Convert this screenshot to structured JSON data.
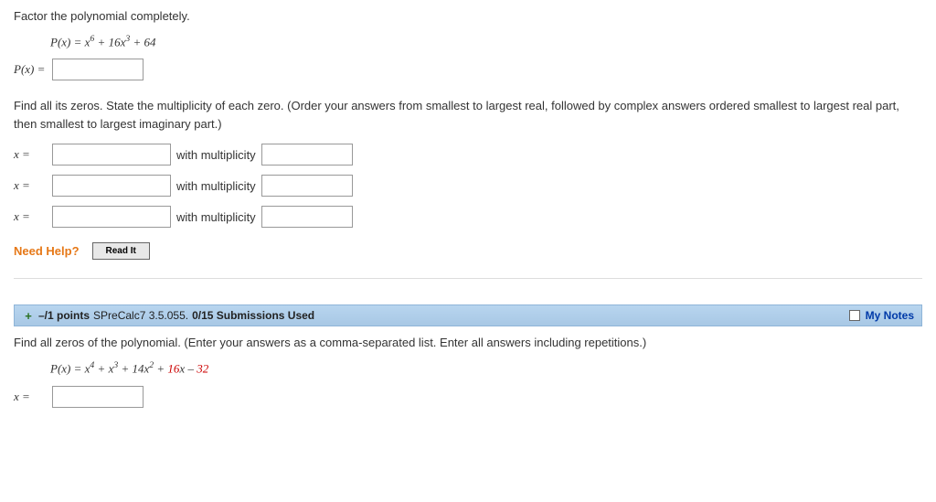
{
  "q1": {
    "prompt": "Factor the polynomial completely.",
    "formula_html": "P(x) = x<sup>6</sup> + 16x<sup>3</sup> + 64",
    "px_label": "P(x) =",
    "zeros_instruction": "Find all its zeros. State the multiplicity of each zero. (Order your answers from smallest to largest real, followed by complex answers ordered smallest to largest real part, then smallest to largest imaginary part.)",
    "x_label": "x =",
    "mult_label": "with multiplicity",
    "need_help": "Need Help?",
    "read_it": "Read It"
  },
  "q2header": {
    "points_prefix": "–/1 points",
    "source": "SPreCalc7 3.5.055.",
    "submissions": "0/15 Submissions Used",
    "my_notes": "My Notes"
  },
  "q2": {
    "prompt": "Find all zeros of the polynomial. (Enter your answers as a comma-separated list. Enter all answers including repetitions.)",
    "formula_html": "P(x) = x<sup>4</sup> + x<sup>3</sup> + 14x<sup>2</sup> + <span class='red'>16</span>x – <span class='red'>32</span>",
    "x_label": "x ="
  }
}
